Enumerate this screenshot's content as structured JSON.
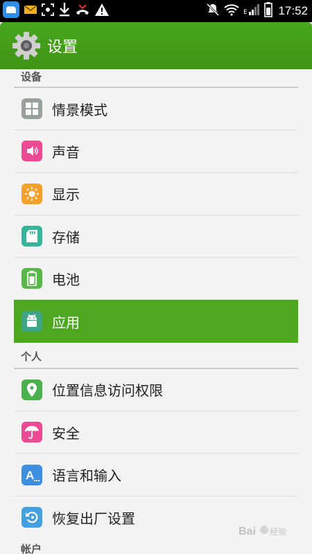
{
  "status_bar": {
    "time": "17:52",
    "left_icons": [
      "weather-app-icon",
      "mail-icon",
      "screenshot-icon",
      "download-icon",
      "missed-call-icon",
      "warning-icon"
    ],
    "right_icons": [
      "mute-icon",
      "wifi-icon",
      "signal-icon",
      "battery-icon"
    ]
  },
  "header": {
    "title": "设置",
    "color": "#43a017"
  },
  "sections": [
    {
      "title": "设备",
      "items": [
        {
          "label": "情景模式",
          "icon": "scene-mode-icon",
          "color": "#9aa09a"
        },
        {
          "label": "声音",
          "icon": "sound-icon",
          "color": "#ec4b94"
        },
        {
          "label": "显示",
          "icon": "display-icon",
          "color": "#f4a12c"
        },
        {
          "label": "存储",
          "icon": "storage-icon",
          "color": "#36b59b"
        },
        {
          "label": "电池",
          "icon": "battery-setting-icon",
          "color": "#58b84a"
        },
        {
          "label": "应用",
          "icon": "android-app-icon",
          "color": "#3fa585",
          "active": true
        }
      ]
    },
    {
      "title": "个人",
      "items": [
        {
          "label": "位置信息访问权限",
          "icon": "location-icon",
          "color": "#4bb04d"
        },
        {
          "label": "安全",
          "icon": "security-icon",
          "color": "#ec4b94"
        },
        {
          "label": "语言和输入",
          "icon": "language-icon",
          "color": "#3f8fe0"
        },
        {
          "label": "恢复出厂设置",
          "icon": "factory-reset-icon",
          "color": "#45a0e0"
        }
      ]
    },
    {
      "title": "帐户",
      "items": []
    }
  ],
  "watermark": "Baidu 经验"
}
